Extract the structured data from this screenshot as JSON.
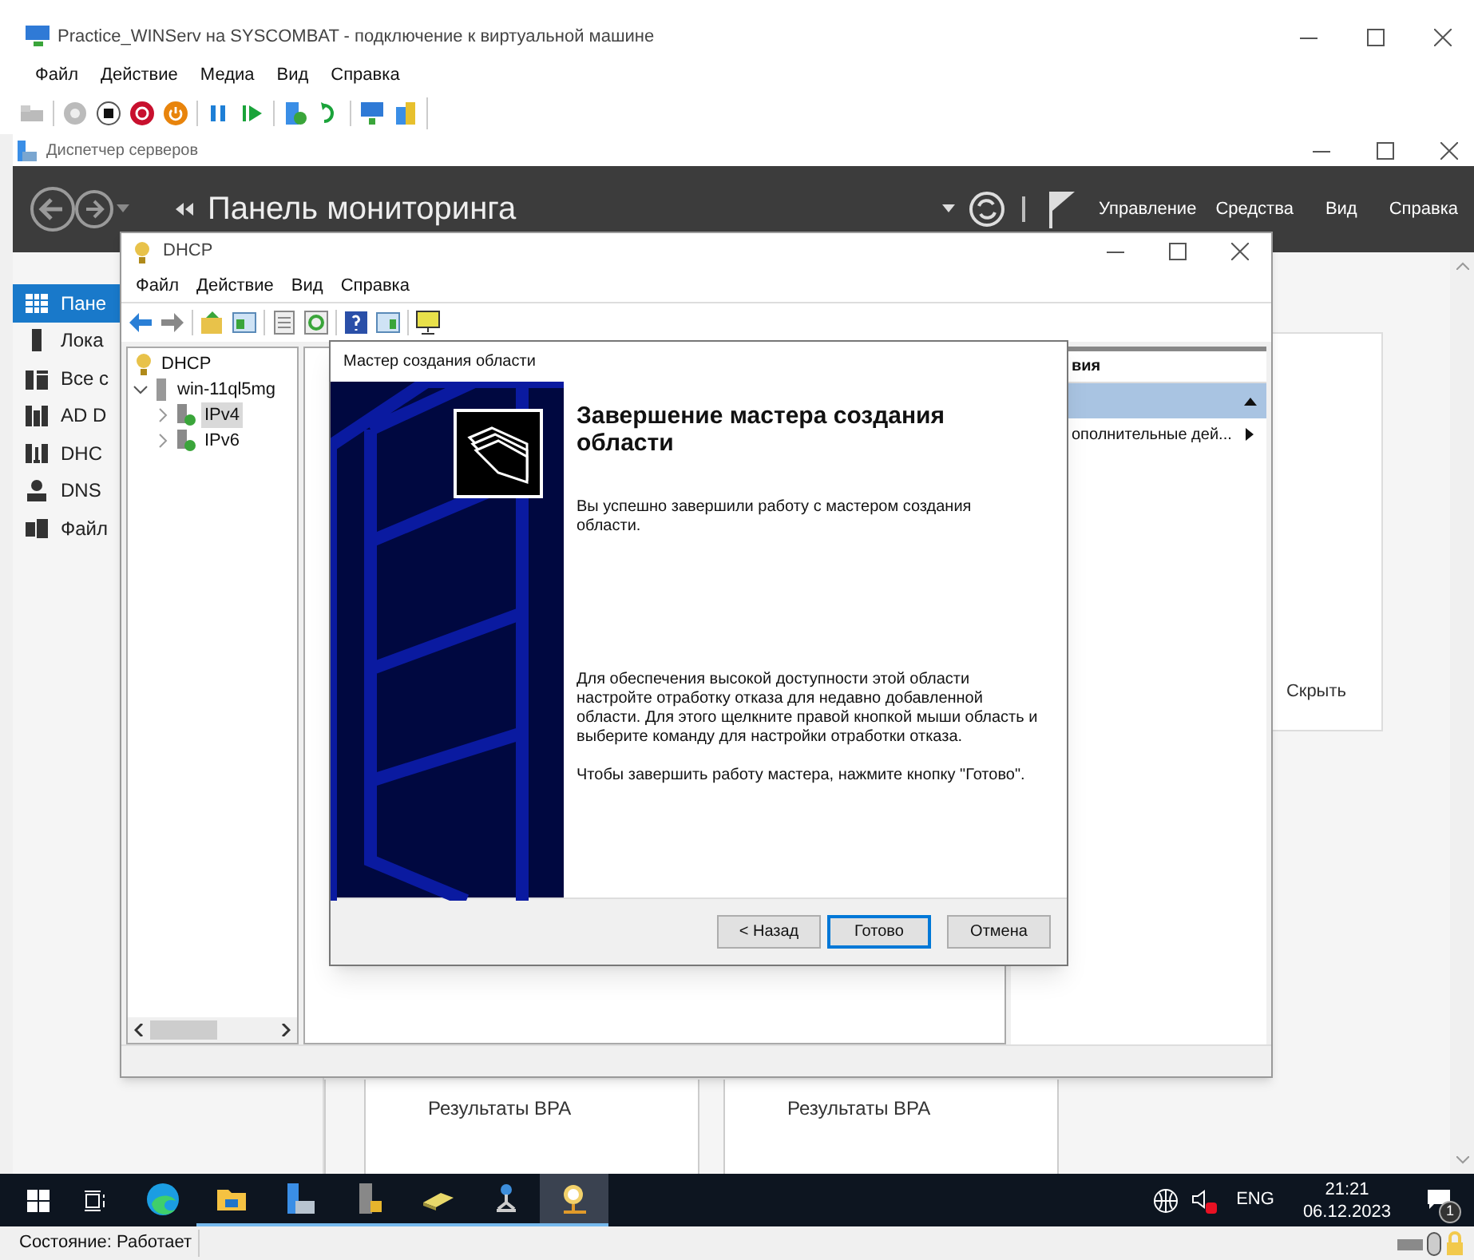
{
  "vm_window": {
    "title": "Practice_WINServ на SYSCOMBAT - подключение к виртуальной машине",
    "menu": [
      "Файл",
      "Действие",
      "Медиа",
      "Вид",
      "Справка"
    ]
  },
  "server_manager": {
    "title": "Диспетчер серверов",
    "header_title": "Панель мониторинга",
    "header_menu": [
      "Управление",
      "Средства",
      "Вид",
      "Справка"
    ],
    "sidebar": [
      {
        "kind": "dashboard",
        "label": "Пане",
        "selected": true
      },
      {
        "kind": "server",
        "label": "Лока",
        "selected": false
      },
      {
        "kind": "servers",
        "label": "Все с",
        "selected": false
      },
      {
        "kind": "adds",
        "label": "AD D",
        "selected": false
      },
      {
        "kind": "dhcp",
        "label": "DHC",
        "selected": false
      },
      {
        "kind": "dns",
        "label": "DNS",
        "selected": false
      },
      {
        "kind": "files",
        "label": "Файл",
        "selected": false
      }
    ],
    "hide_link": "Скрыть",
    "tiles": [
      {
        "label": "Результаты BPA"
      },
      {
        "label": "Результаты BPA"
      }
    ]
  },
  "dhcp_window": {
    "title": "DHCP",
    "menu": [
      "Файл",
      "Действие",
      "Вид",
      "Справка"
    ],
    "tree_root": "DHCP",
    "tree": [
      {
        "label": "win-11ql5mg",
        "expanded": true,
        "selected": false,
        "children": [
          {
            "label": "IPv4",
            "expanded": false,
            "selected": true
          },
          {
            "label": "IPv6",
            "expanded": false,
            "selected": false
          }
        ]
      }
    ],
    "actions": {
      "header": "вия",
      "items": [
        {
          "label": "ополнительные дей..."
        }
      ]
    }
  },
  "wizard": {
    "title": "Мастер создания области",
    "heading": "Завершение мастера создания области",
    "paragraphs": [
      "Вы успешно завершили работу с мастером создания области.",
      "Для обеспечения высокой доступности этой области настройте отработку отказа для недавно добавленной области. Для этого щелкните правой кнопкой мыши область и выберите команду для настройки отработки отказа.",
      "Чтобы завершить работу мастера, нажмите кнопку \"Готово\"."
    ],
    "buttons": [
      {
        "label": "< Назад",
        "selected": false
      },
      {
        "label": "Готово",
        "selected": true
      },
      {
        "label": "Отмена",
        "selected": false
      }
    ]
  },
  "taskbar": {
    "apps": [
      {
        "kind": "edge",
        "active": false
      },
      {
        "kind": "explorer",
        "active": false
      },
      {
        "kind": "server-manager",
        "active": false
      },
      {
        "kind": "server-lock",
        "active": false
      },
      {
        "kind": "scanner",
        "active": false
      },
      {
        "kind": "network",
        "active": false
      },
      {
        "kind": "dhcp",
        "active": true
      }
    ],
    "language": "ENG",
    "time": "21:21",
    "date": "06.12.2023",
    "notification_count": "1"
  },
  "status_bar": {
    "text": "Состояние: Работает"
  }
}
